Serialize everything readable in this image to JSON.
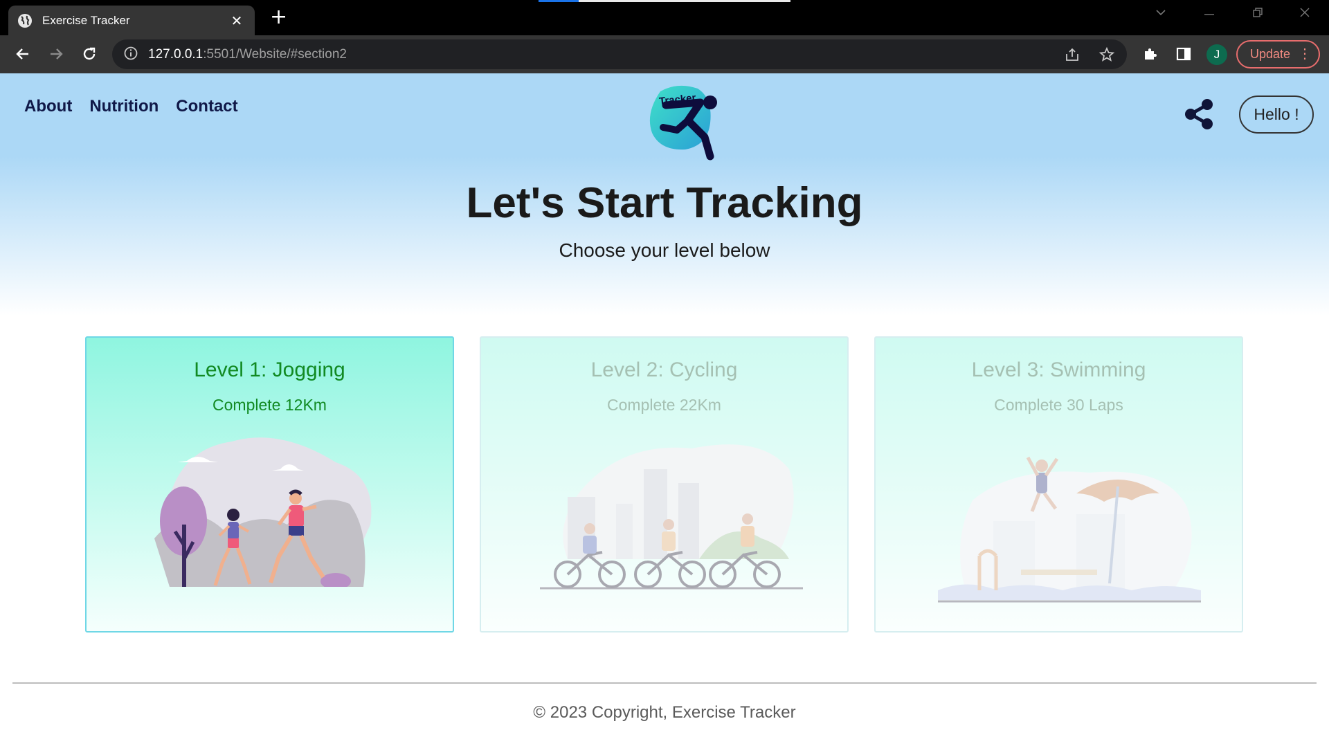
{
  "browser": {
    "tab_title": "Exercise Tracker",
    "tab_close": "✕",
    "new_tab": "+",
    "url_host": "127.0.0.1",
    "url_rest": ":5501/Website/#section2",
    "profile_initial": "J",
    "update_label": "Update",
    "load_progress": 0.16
  },
  "nav": {
    "links": [
      "About",
      "Nutrition",
      "Contact"
    ]
  },
  "logo_text": "Tracker",
  "hello_label": "Hello !",
  "hero": {
    "title": "Let's Start Tracking",
    "subtitle": "Choose your level below"
  },
  "levels": [
    {
      "title": "Level 1: Jogging",
      "goal": "Complete 12Km",
      "illustration": "jogging-illustration",
      "active": true
    },
    {
      "title": "Level 2: Cycling",
      "goal": "Complete 22Km",
      "illustration": "cycling-illustration",
      "active": false
    },
    {
      "title": "Level 3: Swimming",
      "goal": "Complete 30 Laps",
      "illustration": "swimming-illustration",
      "active": false
    }
  ],
  "footer": "© 2023 Copyright, Exercise Tracker",
  "colors": {
    "header_blue": "#acd8f6",
    "nav_text": "#101848",
    "card_green": "#8ff5e0",
    "level_text": "#118a22"
  }
}
